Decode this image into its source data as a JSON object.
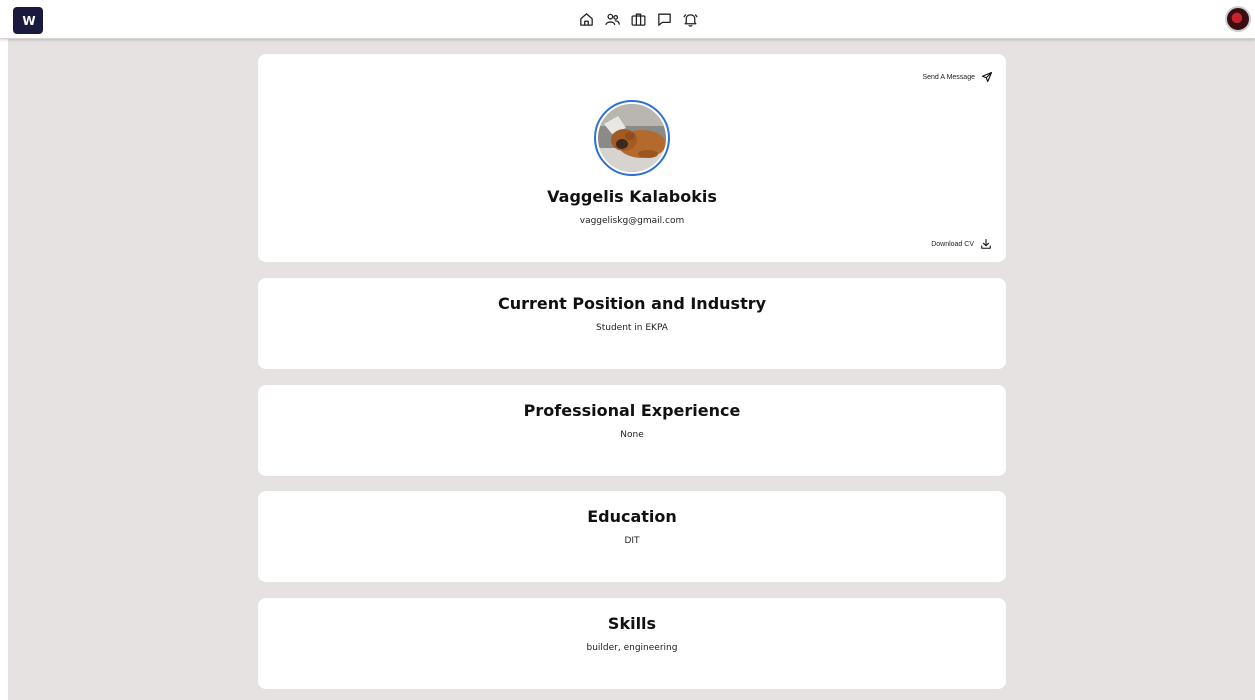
{
  "app": {
    "logo_text": "W",
    "nav_icons": [
      "home-icon",
      "people-icon",
      "briefcase-icon",
      "chat-icon",
      "bell-icon"
    ],
    "colors": {
      "logo_bg": "#1a1a3e",
      "page_bg": "#e6e2e1",
      "card_bg": "#ffffff",
      "photo_ring": "#2f6fd6"
    }
  },
  "profile": {
    "send_message_label": "Send A Message",
    "download_cv_label": "Download CV",
    "name": "Vaggelis Kalabokis",
    "email": "vaggeliskg@gmail.com"
  },
  "sections": [
    {
      "title": "Current Position and Industry",
      "value": "Student in EKPA"
    },
    {
      "title": "Professional Experience",
      "value": "None"
    },
    {
      "title": "Education",
      "value": "DIT"
    },
    {
      "title": "Skills",
      "value": "builder, engineering"
    }
  ]
}
